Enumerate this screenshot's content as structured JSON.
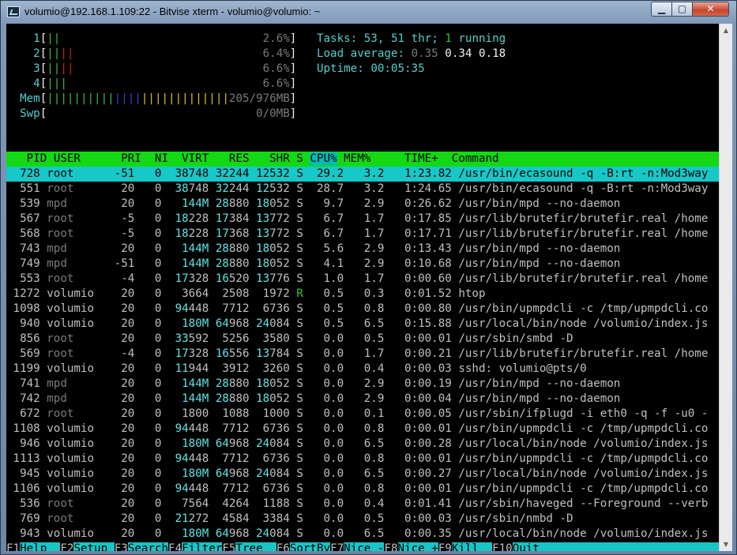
{
  "window": {
    "title": "volumio@192.168.1.109:22 - Bitvise xterm - volumio@volumio: ~",
    "minimize_glyph": "▁",
    "maximize_glyph": "▢",
    "close_glyph": "✕"
  },
  "meters": {
    "cpu": [
      {
        "label": "1",
        "bars": [
          {
            "t": "||",
            "c": "green"
          }
        ],
        "value": "2.6%"
      },
      {
        "label": "2",
        "bars": [
          {
            "t": "||",
            "c": "green"
          },
          {
            "t": "||",
            "c": "red"
          }
        ],
        "value": "6.4%"
      },
      {
        "label": "3",
        "bars": [
          {
            "t": "||",
            "c": "green"
          },
          {
            "t": "||",
            "c": "red"
          }
        ],
        "value": "6.6%"
      },
      {
        "label": "4",
        "bars": [
          {
            "t": "|||",
            "c": "green"
          }
        ],
        "value": "6.6%"
      }
    ],
    "mem": {
      "label": "Mem",
      "bars": [
        {
          "t": "||||||||||",
          "c": "green"
        },
        {
          "t": "||||",
          "c": "blue"
        },
        {
          "t": "|||||||||||||",
          "c": "yellow"
        }
      ],
      "value": "205/976MB"
    },
    "swp": {
      "label": "Swp",
      "bars": [],
      "value": "0/0MB"
    }
  },
  "summary": {
    "tasks_label": "Tasks: ",
    "tasks_count": "53",
    "tasks_sep": ", ",
    "threads": "51",
    "threads_label": " thr; ",
    "running_count": "1",
    "running_label": " running",
    "load_label": "Load average: ",
    "load1": "0.35",
    "load5": "0.34",
    "load15": "0.18",
    "uptime_label": "Uptime: ",
    "uptime": "00:05:35"
  },
  "columns": [
    "PID",
    "USER",
    "PRI",
    "NI",
    "VIRT",
    "RES",
    "SHR",
    "S",
    "CPU%",
    "MEM%",
    "TIME+",
    "Command"
  ],
  "sort_column": "CPU%",
  "processes": [
    {
      "pid": "728",
      "user": "root",
      "pri": "-51",
      "ni": "0",
      "virt": "38748",
      "res": "32244",
      "shr": "12532",
      "s": "S",
      "cpu": "29.2",
      "mem": "3.2",
      "time": "1:23.82",
      "cmd": "/usr/bin/ecasound -q -B:rt -n:Mod3way",
      "selected": true
    },
    {
      "pid": "551",
      "user": "root",
      "pri": "20",
      "ni": "0",
      "virt": "38748",
      "res": "32244",
      "shr": "12532",
      "s": "S",
      "cpu": "28.7",
      "mem": "3.2",
      "time": "1:24.65",
      "cmd": "/usr/bin/ecasound -q -B:rt -n:Mod3way"
    },
    {
      "pid": "539",
      "user": "mpd",
      "pri": "20",
      "ni": "0",
      "virt": "144M",
      "res": "28880",
      "shr": "18052",
      "s": "S",
      "cpu": "9.7",
      "mem": "2.9",
      "time": "0:26.62",
      "cmd": "/usr/bin/mpd --no-daemon"
    },
    {
      "pid": "567",
      "user": "root",
      "pri": "-5",
      "ni": "0",
      "virt": "18228",
      "res": "17384",
      "shr": "13772",
      "s": "S",
      "cpu": "6.7",
      "mem": "1.7",
      "time": "0:17.85",
      "cmd": "/usr/lib/brutefir/brutefir.real /home"
    },
    {
      "pid": "568",
      "user": "root",
      "pri": "-5",
      "ni": "0",
      "virt": "18228",
      "res": "17368",
      "shr": "13772",
      "s": "S",
      "cpu": "6.7",
      "mem": "1.7",
      "time": "0:17.71",
      "cmd": "/usr/lib/brutefir/brutefir.real /home"
    },
    {
      "pid": "743",
      "user": "mpd",
      "pri": "20",
      "ni": "0",
      "virt": "144M",
      "res": "28880",
      "shr": "18052",
      "s": "S",
      "cpu": "5.6",
      "mem": "2.9",
      "time": "0:13.43",
      "cmd": "/usr/bin/mpd --no-daemon"
    },
    {
      "pid": "749",
      "user": "mpd",
      "pri": "-51",
      "ni": "0",
      "virt": "144M",
      "res": "28880",
      "shr": "18052",
      "s": "S",
      "cpu": "4.1",
      "mem": "2.9",
      "time": "0:10.68",
      "cmd": "/usr/bin/mpd --no-daemon"
    },
    {
      "pid": "553",
      "user": "root",
      "pri": "-4",
      "ni": "0",
      "virt": "17328",
      "res": "16520",
      "shr": "13776",
      "s": "S",
      "cpu": "1.0",
      "mem": "1.7",
      "time": "0:00.60",
      "cmd": "/usr/lib/brutefir/brutefir.real /home"
    },
    {
      "pid": "1272",
      "user": "volumio",
      "pri": "20",
      "ni": "0",
      "virt": "3664",
      "res": "2508",
      "shr": "1972",
      "s": "R",
      "cpu": "0.5",
      "mem": "0.3",
      "time": "0:01.52",
      "cmd": "htop"
    },
    {
      "pid": "1098",
      "user": "volumio",
      "pri": "20",
      "ni": "0",
      "virt": "94448",
      "res": "7712",
      "shr": "6736",
      "s": "S",
      "cpu": "0.5",
      "mem": "0.8",
      "time": "0:00.80",
      "cmd": "/usr/bin/upmpdcli -c /tmp/upmpdcli.co"
    },
    {
      "pid": "940",
      "user": "volumio",
      "pri": "20",
      "ni": "0",
      "virt": "180M",
      "res": "64968",
      "shr": "24084",
      "s": "S",
      "cpu": "0.5",
      "mem": "6.5",
      "time": "0:15.88",
      "cmd": "/usr/local/bin/node /volumio/index.js"
    },
    {
      "pid": "856",
      "user": "root",
      "pri": "20",
      "ni": "0",
      "virt": "33592",
      "res": "5256",
      "shr": "3580",
      "s": "S",
      "cpu": "0.0",
      "mem": "0.5",
      "time": "0:00.01",
      "cmd": "/usr/sbin/smbd -D"
    },
    {
      "pid": "569",
      "user": "root",
      "pri": "-4",
      "ni": "0",
      "virt": "17328",
      "res": "16556",
      "shr": "13784",
      "s": "S",
      "cpu": "0.0",
      "mem": "1.7",
      "time": "0:00.21",
      "cmd": "/usr/lib/brutefir/brutefir.real /home"
    },
    {
      "pid": "1199",
      "user": "volumio",
      "pri": "20",
      "ni": "0",
      "virt": "11944",
      "res": "3912",
      "shr": "3260",
      "s": "S",
      "cpu": "0.0",
      "mem": "0.4",
      "time": "0:00.03",
      "cmd": "sshd: volumio@pts/0"
    },
    {
      "pid": "741",
      "user": "mpd",
      "pri": "20",
      "ni": "0",
      "virt": "144M",
      "res": "28880",
      "shr": "18052",
      "s": "S",
      "cpu": "0.0",
      "mem": "2.9",
      "time": "0:00.19",
      "cmd": "/usr/bin/mpd --no-daemon"
    },
    {
      "pid": "742",
      "user": "mpd",
      "pri": "20",
      "ni": "0",
      "virt": "144M",
      "res": "28880",
      "shr": "18052",
      "s": "S",
      "cpu": "0.0",
      "mem": "2.9",
      "time": "0:00.04",
      "cmd": "/usr/bin/mpd --no-daemon"
    },
    {
      "pid": "672",
      "user": "root",
      "pri": "20",
      "ni": "0",
      "virt": "1800",
      "res": "1088",
      "shr": "1000",
      "s": "S",
      "cpu": "0.0",
      "mem": "0.1",
      "time": "0:00.05",
      "cmd": "/usr/sbin/ifplugd -i eth0 -q -f -u0 -"
    },
    {
      "pid": "1108",
      "user": "volumio",
      "pri": "20",
      "ni": "0",
      "virt": "94448",
      "res": "7712",
      "shr": "6736",
      "s": "S",
      "cpu": "0.0",
      "mem": "0.8",
      "time": "0:00.01",
      "cmd": "/usr/bin/upmpdcli -c /tmp/upmpdcli.co"
    },
    {
      "pid": "946",
      "user": "volumio",
      "pri": "20",
      "ni": "0",
      "virt": "180M",
      "res": "64968",
      "shr": "24084",
      "s": "S",
      "cpu": "0.0",
      "mem": "6.5",
      "time": "0:00.28",
      "cmd": "/usr/local/bin/node /volumio/index.js"
    },
    {
      "pid": "1113",
      "user": "volumio",
      "pri": "20",
      "ni": "0",
      "virt": "94448",
      "res": "7712",
      "shr": "6736",
      "s": "S",
      "cpu": "0.0",
      "mem": "0.8",
      "time": "0:00.01",
      "cmd": "/usr/bin/upmpdcli -c /tmp/upmpdcli.co"
    },
    {
      "pid": "945",
      "user": "volumio",
      "pri": "20",
      "ni": "0",
      "virt": "180M",
      "res": "64968",
      "shr": "24084",
      "s": "S",
      "cpu": "0.0",
      "mem": "6.5",
      "time": "0:00.27",
      "cmd": "/usr/local/bin/node /volumio/index.js"
    },
    {
      "pid": "1106",
      "user": "volumio",
      "pri": "20",
      "ni": "0",
      "virt": "94448",
      "res": "7712",
      "shr": "6736",
      "s": "S",
      "cpu": "0.0",
      "mem": "0.8",
      "time": "0:00.01",
      "cmd": "/usr/bin/upmpdcli -c /tmp/upmpdcli.co"
    },
    {
      "pid": "536",
      "user": "root",
      "pri": "20",
      "ni": "0",
      "virt": "7564",
      "res": "4264",
      "shr": "1188",
      "s": "S",
      "cpu": "0.0",
      "mem": "0.4",
      "time": "0:01.41",
      "cmd": "/usr/sbin/haveged --Foreground --verb"
    },
    {
      "pid": "769",
      "user": "root",
      "pri": "20",
      "ni": "0",
      "virt": "21272",
      "res": "4584",
      "shr": "3384",
      "s": "S",
      "cpu": "0.0",
      "mem": "0.5",
      "time": "0:00.03",
      "cmd": "/usr/sbin/nmbd -D"
    },
    {
      "pid": "943",
      "user": "volumio",
      "pri": "20",
      "ni": "0",
      "virt": "180M",
      "res": "64968",
      "shr": "24084",
      "s": "S",
      "cpu": "0.0",
      "mem": "6.5",
      "time": "0:00.35",
      "cmd": "/usr/local/bin/node /volumio/index.js"
    }
  ],
  "function_keys": [
    {
      "key": "F1",
      "label": "Help  "
    },
    {
      "key": "F2",
      "label": "Setup "
    },
    {
      "key": "F3",
      "label": "Search"
    },
    {
      "key": "F4",
      "label": "Filter"
    },
    {
      "key": "F5",
      "label": "Tree  "
    },
    {
      "key": "F6",
      "label": "SortBy"
    },
    {
      "key": "F7",
      "label": "Nice -"
    },
    {
      "key": "F8",
      "label": "Nice +"
    },
    {
      "key": "F9",
      "label": "Kill  "
    },
    {
      "key": "F10",
      "label": "Quit"
    }
  ],
  "scrollbar": {
    "up_glyph": "▲",
    "down_glyph": "▼"
  },
  "colors": {
    "header_bg": "#14d814",
    "selected_bg": "#17c8c8",
    "cyan": "#4fd0d0",
    "green": "#33c233",
    "red": "#d02020",
    "blue": "#3a3ae0",
    "yellow": "#d6c21a"
  }
}
